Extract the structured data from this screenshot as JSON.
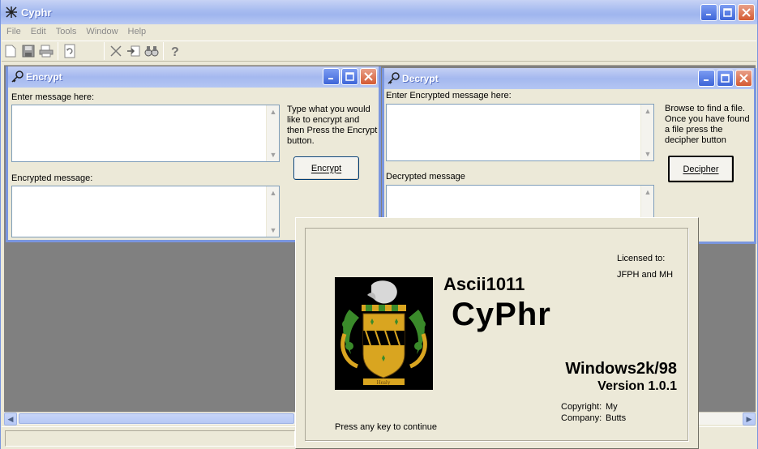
{
  "app": {
    "title": "Cyphr"
  },
  "menu": [
    "File",
    "Edit",
    "Tools",
    "Window",
    "Help"
  ],
  "toolbar": {
    "icons": [
      "new-file-icon",
      "save-icon",
      "print-icon",
      "refresh-icon",
      "cut-icon",
      "import-icon",
      "find-icon",
      "help-icon"
    ]
  },
  "encrypt": {
    "title": "Encrypt",
    "input_label": "Enter message here:",
    "input_value": "",
    "output_label": "Encrypted message:",
    "output_value": "",
    "help": "Type what you would like to encrypt and then Press the Encrypt button.",
    "button": "Encrypt"
  },
  "decrypt": {
    "title": "Decrypt",
    "input_label": "Enter Encrypted message here:",
    "input_value": "",
    "output_label": "Decrypted message",
    "output_value": "",
    "help": "Browse to find a file. Once you have found a file press the decipher button",
    "button": "Decipher"
  },
  "splash": {
    "company": "Ascii1011",
    "product": "CyPhr",
    "licensed_label": "Licensed to:",
    "licensed_value": "JFPH and MH",
    "platform": "Windows2k/98",
    "version": "Version 1.0.1",
    "copyright_label": "Copyright:",
    "copyright_value": "My",
    "company_label": "Company:",
    "company_value": "Butts",
    "prompt": "Press any key to continue",
    "crest_caption": "Healy"
  },
  "colors": {
    "xp_blue": "#7a96df",
    "mdi_bg": "#808080",
    "face": "#ece9d8"
  }
}
